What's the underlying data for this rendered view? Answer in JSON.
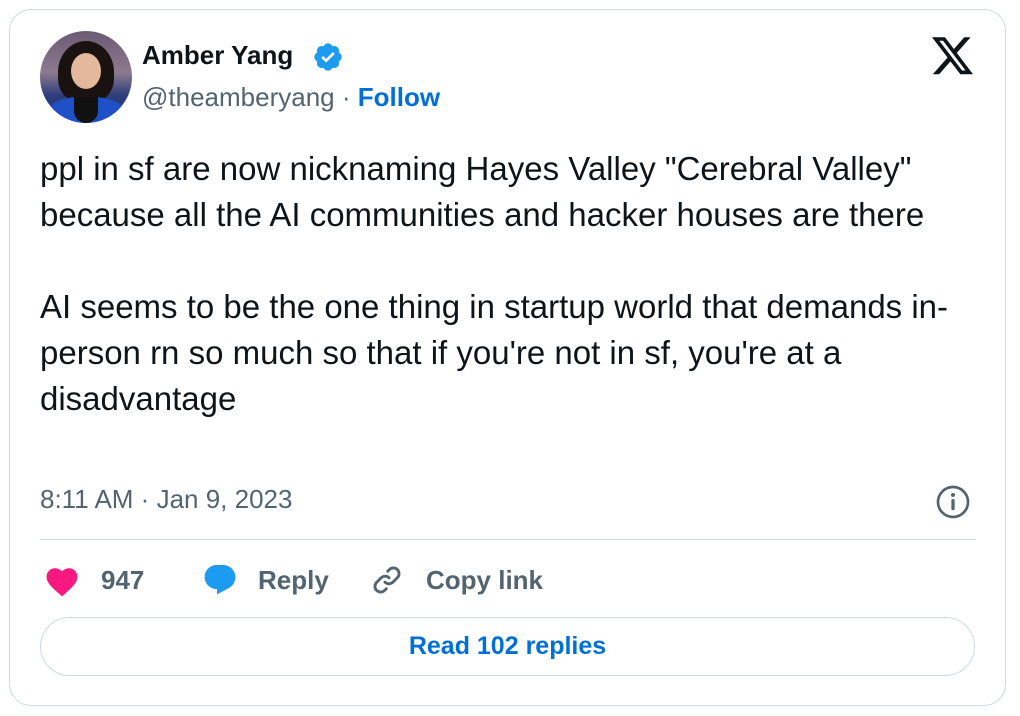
{
  "author": {
    "name": "Amber Yang",
    "handle": "@theamberyang",
    "separator": " · ",
    "follow_label": "Follow",
    "verified": true
  },
  "tweet": {
    "text": "ppl in sf are now nicknaming Hayes Valley \"Cerebral Valley\" because all the AI communities and hacker houses are there\n\nAI seems to be the one thing in startup world that demands in-person rn so much so that if you're not in sf, you're at a disadvantage",
    "timestamp": "8:11 AM · Jan 9, 2023"
  },
  "actions": {
    "like_count": "947",
    "reply_label": "Reply",
    "copy_link_label": "Copy link"
  },
  "read_replies_label": "Read 102 replies",
  "colors": {
    "accent": "#006fd6",
    "verified": "#1d9bf0",
    "like": "#f91880",
    "secondary_text": "#536471",
    "border": "#cfd9de"
  },
  "icons": [
    "x-logo-icon",
    "verified-badge-icon",
    "info-icon",
    "heart-icon",
    "reply-bubble-icon",
    "link-icon"
  ]
}
